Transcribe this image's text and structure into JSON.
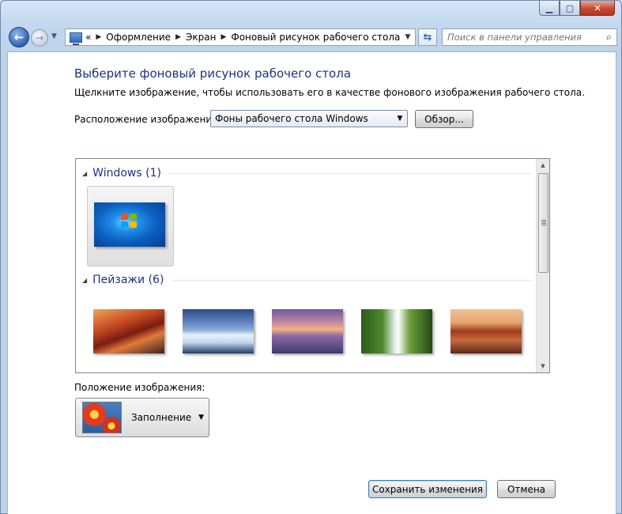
{
  "window": {
    "minimize_glyph": "▁",
    "maximize_glyph": "▢",
    "close_glyph": "✕"
  },
  "nav": {
    "breadcrumb_prefix": "«",
    "breadcrumbs": [
      "Оформление",
      "Экран",
      "Фоновый рисунок рабочего стола"
    ],
    "search_placeholder": "Поиск в панели управления"
  },
  "main": {
    "title": "Выберите фоновый рисунок рабочего стола",
    "subtitle": "Щелкните изображение, чтобы использовать его в качестве фонового изображения рабочего стола.",
    "location_label": "Расположение изображения:",
    "location_value": "Фоны рабочего стола Windows",
    "browse_label": "Обзор..."
  },
  "gallery": {
    "groups": [
      {
        "title": "Windows (1)"
      },
      {
        "title": "Пейзажи (6)"
      }
    ]
  },
  "position": {
    "label": "Положение изображения:",
    "value": "Заполнение"
  },
  "footer": {
    "save_label": "Сохранить изменения",
    "cancel_label": "Отмена"
  },
  "colors": {
    "heading": "#1e3287",
    "window_glass": "#c3d8ee"
  }
}
